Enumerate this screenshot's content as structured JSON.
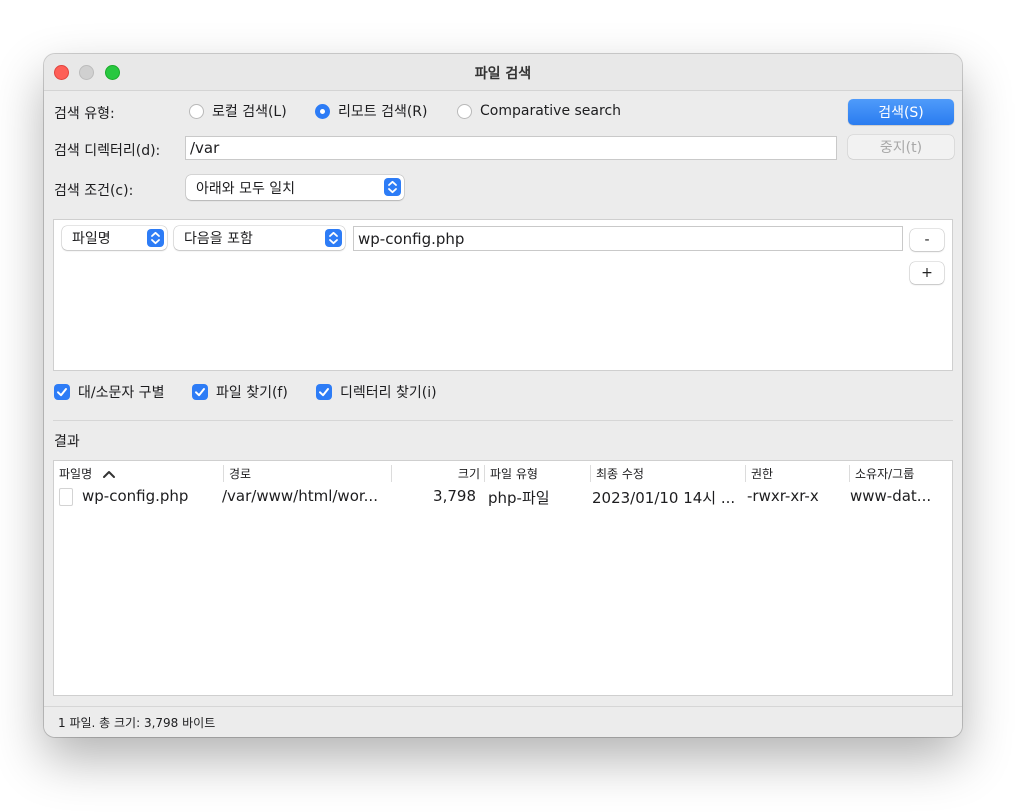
{
  "window": {
    "title": "파일 검색"
  },
  "search_type": {
    "label": "검색 유형:",
    "options": [
      {
        "label": "로컬 검색(L)",
        "selected": false
      },
      {
        "label": "리모트 검색(R)",
        "selected": true
      },
      {
        "label": "Comparative search",
        "selected": false
      }
    ]
  },
  "search_dir": {
    "label": "검색 디렉터리(d):",
    "value": "/var"
  },
  "search_condition": {
    "label": "검색 조건(c):",
    "value": "아래와 모두 일치"
  },
  "buttons": {
    "search": "검색(S)",
    "stop": "중지(t)"
  },
  "criteria": [
    {
      "field": "파일명",
      "operator": "다음을 포함",
      "value": "wp-config.php",
      "remove_label": "-",
      "add_label": "+"
    }
  ],
  "options": [
    {
      "label": "대/소문자 구별",
      "checked": true
    },
    {
      "label": "파일 찾기(f)",
      "checked": true
    },
    {
      "label": "디렉터리 찾기(i)",
      "checked": true
    }
  ],
  "results": {
    "label": "결과",
    "columns": [
      "파일명",
      "경로",
      "크기",
      "파일 유형",
      "최종 수정",
      "권한",
      "소유자/그룹"
    ],
    "sort_indicator": "chevron-up-icon",
    "rows": [
      {
        "name": "wp-config.php",
        "path": "/var/www/html/wor...",
        "size": "3,798",
        "type": "php-파일",
        "modified": "2023/01/10 14시 ...",
        "permissions": "-rwxr-xr-x",
        "owner": "www-dat..."
      }
    ]
  },
  "status": "1 파일. 총 크기: 3,798 바이트",
  "colors": {
    "accent": "#2d7cf6",
    "close": "#fe5f57",
    "maximize": "#28c840"
  }
}
